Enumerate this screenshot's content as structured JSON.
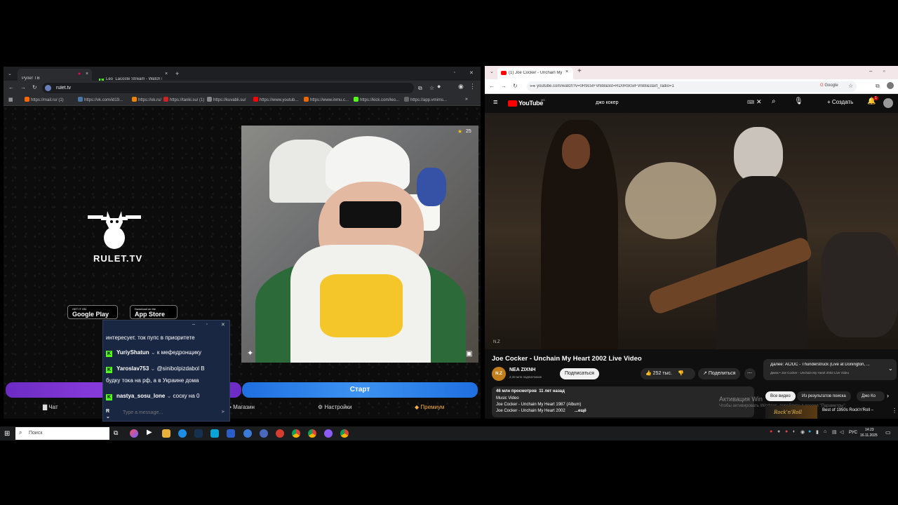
{
  "left_browser": {
    "tabs": [
      {
        "label": "Рулет ТВ"
      },
      {
        "label": "Leo_Lacoste Stream - Watch L..."
      }
    ],
    "url": "rulet.tv",
    "bookmarks": [
      "https://mail.ru/ (1)",
      "https://vk.com/id19...",
      "https://ok.ru/",
      "https://tanki.su/ (1)",
      "https://kuvabli.su/",
      "https://www.youtub...",
      "https://www.inmu.c...",
      "https://kick.com/leo...",
      "https://app.vmims..."
    ],
    "site": {
      "logo_text": "RULET.TV",
      "google_play": {
        "small": "GET IT ON",
        "big": "Google Play"
      },
      "app_store": {
        "small": "Download on the",
        "big": "App Store"
      },
      "star_count": "25",
      "start_button": "Старт",
      "nav": {
        "chat": "Чат",
        "shop": "Магазин",
        "settings": "Настройки",
        "premium": "Премиум"
      }
    },
    "chat_popup": {
      "messages": [
        {
          "user": "",
          "text": "интересует. ток пупс в приоритете"
        },
        {
          "user": "YuriyShatun",
          "text": "к мефедронщику"
        },
        {
          "user": "Yaroslav753",
          "text": "@sinibolpizdabol В"
        },
        {
          "user": "",
          "text": "будку тока на рф, а в Украине дома"
        },
        {
          "user": "nastya_sosu_lone",
          "text": "соску на 0"
        }
      ],
      "input_placeholder": "Type a message..."
    }
  },
  "right_browser": {
    "tab": {
      "label": "(1) Joe Cocker - Unchain My H..."
    },
    "url": "youtube.com/watch?v=0R9c5IFVrB8&list=RD0R9c5IFVrB8&start_radio=1",
    "search_engine": "Google",
    "youtube": {
      "logo": "YouTube",
      "logo_badge": "MD",
      "search_value": "джо кокер",
      "create_label": "Создать",
      "notif_count": "1",
      "video_title": "Joe Cocker - Unchain My Heart 2002 Live Video",
      "channel_name": "NEA ZIXNH",
      "channel_avatar": "N.Z",
      "subscribers": "2,33 млн подписчиков",
      "subscribe_label": "Подписаться",
      "likes": "252 тыс.",
      "share_label": "Поделиться",
      "next_label": "Далее: AC/DC - Thunderstruck (Live at Donington, ...",
      "next_sub": "Джем • Joe Cocker - Unchain My Heart 2002 Live Video",
      "description": {
        "stats": "46 млн просмотров  11 лет назад",
        "line1": "Music Video",
        "line2": "Joe Cocker - Unchain My Heart 1987 (Album)",
        "line3": "Joe Cocker - Unchain My Heart 2002",
        "more": "...ещё"
      },
      "filters": [
        "Все видео",
        "Из результатов поиска",
        "Джо Ко"
      ],
      "rec_title": "Best of 1950s Rock'n'Roll –",
      "rec_thumb": "Rock'n'Roll",
      "watermark": "N.Z",
      "activation_title": "Активация Win",
      "activation_sub": "Чтобы активировать Windows, перейдите в раздел \"Параметры\"."
    }
  },
  "taskbar": {
    "search_placeholder": "Поиск",
    "lang": "РУС",
    "time": "14:23",
    "date": "16.11.2025"
  },
  "colors": {
    "kick_green": "#53fc18",
    "youtube_red": "#ff0000",
    "rulet_purple": "#7b34d6",
    "rulet_blue": "#2f86ec"
  }
}
